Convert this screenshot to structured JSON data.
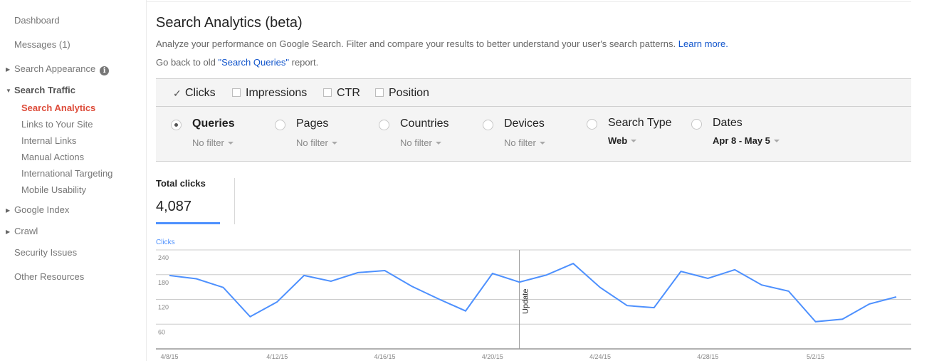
{
  "sidebar": {
    "items": [
      {
        "label": "Dashboard"
      },
      {
        "label": "Messages (1)"
      },
      {
        "label": "Search Appearance",
        "icon": "info-icon"
      },
      {
        "label": "Search Traffic",
        "expanded": true,
        "children": [
          {
            "label": "Search Analytics",
            "active": true
          },
          {
            "label": "Links to Your Site"
          },
          {
            "label": "Internal Links"
          },
          {
            "label": "Manual Actions"
          },
          {
            "label": "International Targeting"
          },
          {
            "label": "Mobile Usability"
          }
        ]
      },
      {
        "label": "Google Index"
      },
      {
        "label": "Crawl"
      },
      {
        "label": "Security Issues"
      },
      {
        "label": "Other Resources"
      }
    ]
  },
  "header": {
    "title": "Search Analytics (beta)",
    "description": "Analyze your performance on Google Search. Filter and compare your results to better understand your user's search patterns.",
    "learn_more": "Learn more.",
    "old_report_prefix": "Go back to old ",
    "old_report_link": "\"Search Queries\"",
    "old_report_suffix": " report."
  },
  "metrics": [
    {
      "label": "Clicks",
      "checked": true
    },
    {
      "label": "Impressions",
      "checked": false
    },
    {
      "label": "CTR",
      "checked": false
    },
    {
      "label": "Position",
      "checked": false
    }
  ],
  "group_by": [
    {
      "label": "Queries",
      "selected": true,
      "filter": "No filter"
    },
    {
      "label": "Pages",
      "selected": false,
      "filter": "No filter"
    },
    {
      "label": "Countries",
      "selected": false,
      "filter": "No filter"
    },
    {
      "label": "Devices",
      "selected": false,
      "filter": "No filter"
    },
    {
      "label": "Search Type",
      "selected": false,
      "filter": "Web"
    },
    {
      "label": "Dates",
      "selected": false,
      "filter": "Apr 8 - May 5"
    }
  ],
  "totals": {
    "label": "Total clicks",
    "value": "4,087"
  },
  "colors": {
    "accent": "#4d90fe",
    "active_nav": "#dd4b39",
    "link": "#1155cc",
    "panel_bg": "#f4f4f4"
  },
  "chart_data": {
    "type": "line",
    "title": "",
    "series_label": "Clicks",
    "xlabel": "",
    "ylabel": "Clicks",
    "ylim": [
      0,
      240
    ],
    "y_ticks": [
      60,
      120,
      180,
      240
    ],
    "grid": true,
    "x": [
      "4/8/15",
      "4/9/15",
      "4/10/15",
      "4/11/15",
      "4/12/15",
      "4/13/15",
      "4/14/15",
      "4/15/15",
      "4/16/15",
      "4/17/15",
      "4/18/15",
      "4/19/15",
      "4/20/15",
      "4/21/15",
      "4/22/15",
      "4/23/15",
      "4/24/15",
      "4/25/15",
      "4/26/15",
      "4/27/15",
      "4/28/15",
      "4/29/15",
      "4/30/15",
      "5/1/15",
      "5/2/15",
      "5/3/15",
      "5/4/15",
      "5/5/15"
    ],
    "x_tick_labels": [
      "4/8/15",
      "4/12/15",
      "4/16/15",
      "4/20/15",
      "4/24/15",
      "4/28/15",
      "5/2/15"
    ],
    "series": [
      {
        "name": "Clicks",
        "color": "#4d90fe",
        "values": [
          178,
          170,
          149,
          78,
          114,
          178,
          164,
          185,
          190,
          152,
          121,
          92,
          183,
          162,
          179,
          207,
          149,
          105,
          100,
          188,
          171,
          192,
          155,
          140,
          66,
          72,
          109,
          126
        ]
      }
    ],
    "annotations": [
      {
        "x": "4/21/15",
        "label": "Update"
      }
    ]
  }
}
